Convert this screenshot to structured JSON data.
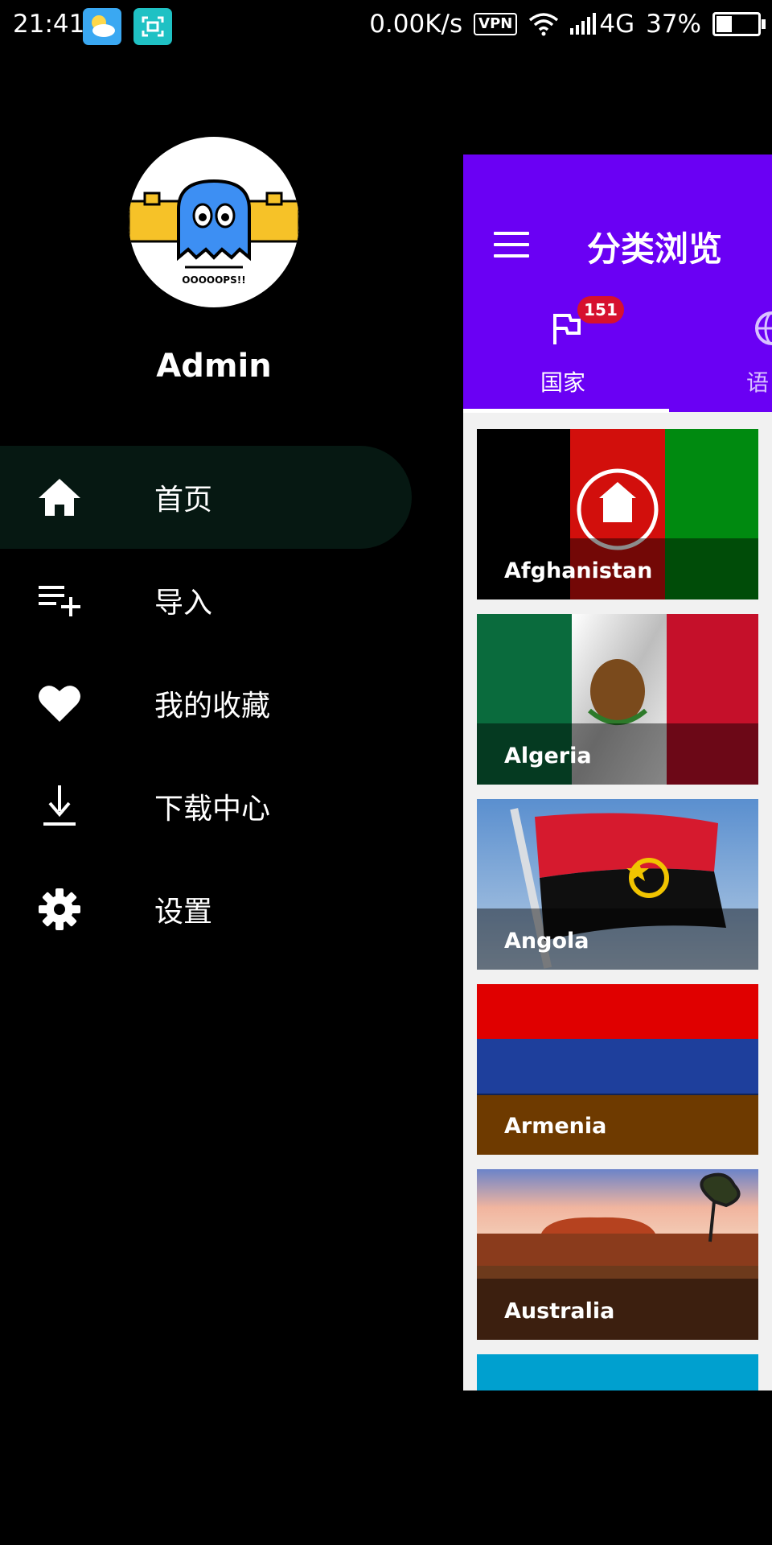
{
  "status_bar": {
    "time": "21:41",
    "network_speed": "0.00K/s",
    "vpn": "VPN",
    "network_type": "4G",
    "battery": "37%",
    "battery_level": 0.37,
    "icons": [
      "weather-icon",
      "screenshot-icon",
      "wifi-icon",
      "signal-icon",
      "battery-icon"
    ]
  },
  "drawer": {
    "avatar_text": "OOOOOPS!!",
    "username": "Admin",
    "items": [
      {
        "label": "首页",
        "icon": "home-icon",
        "active": true
      },
      {
        "label": "导入",
        "icon": "playlist-add-icon",
        "active": false
      },
      {
        "label": "我的收藏",
        "icon": "heart-icon",
        "active": false
      },
      {
        "label": "下载中心",
        "icon": "download-icon",
        "active": false
      },
      {
        "label": "设置",
        "icon": "gear-icon",
        "active": false
      }
    ]
  },
  "main": {
    "title": "分类浏览",
    "tabs": [
      {
        "label": "国家",
        "icon": "flag-icon",
        "badge": "151",
        "selected": true
      },
      {
        "label": "语",
        "icon": "globe-icon",
        "selected": false
      }
    ],
    "cards": [
      {
        "name": "Afghanistan"
      },
      {
        "name": "Algeria"
      },
      {
        "name": "Angola"
      },
      {
        "name": "Armenia"
      },
      {
        "name": "Australia"
      }
    ]
  },
  "colors": {
    "app_bar": "#6a00f4",
    "drawer_active": "#061812",
    "badge": "#d6112e",
    "panel_bg": "#f1f1f1"
  }
}
